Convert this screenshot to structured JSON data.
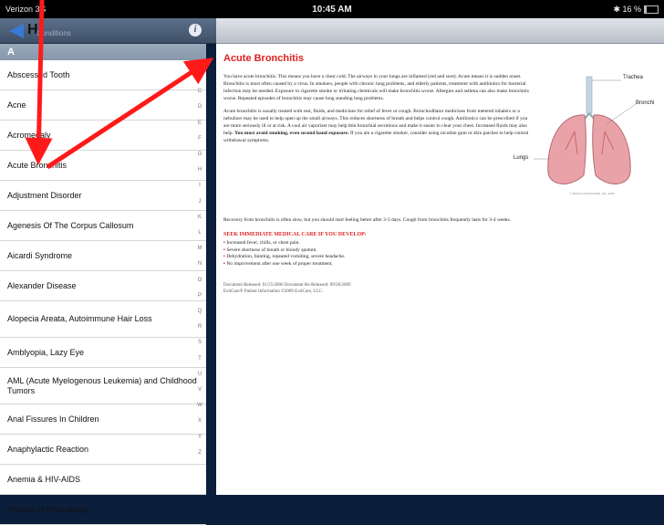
{
  "status": {
    "carrier": "Verizon 3G",
    "time": "10:45 AM",
    "battery": "16 %"
  },
  "left_nav": {
    "home_glyph": "H"
  },
  "search_ghost": "Conditions",
  "section_header": "A",
  "list_items": [
    "Abscessed Tooth",
    "Acne",
    "Acromegaly",
    "Acute Bronchitis",
    "Adjustment Disorder",
    "Agenesis Of The Corpus Callosum",
    "Aicardi Syndrome",
    "Alexander Disease",
    "Alopecia Areata, Autoimmune Hair Loss",
    "Amblyopia, Lazy Eye",
    "AML (Acute Myelogenous Leukemia) and Childhood Tumors",
    "Anal Fissures In Children",
    "Anaphylactic Reaction",
    "Anemia & HIV-AIDS",
    "Anemia of Prematurity"
  ],
  "index_letters": [
    "B",
    "C",
    "D",
    "E",
    "F",
    "G",
    "H",
    "I",
    "J",
    "K",
    "L",
    "M",
    "N",
    "O",
    "P",
    "Q",
    "R",
    "S",
    "T",
    "U",
    "V",
    "W",
    "X",
    "Y",
    "Z"
  ],
  "article": {
    "title": "Acute Bronchitis",
    "para1": "You have acute bronchitis. This means you have a chest cold. The airways in your lungs are inflamed (red and sore). Acute means it is sudden onset. Bronchitis is most often caused by a virus. In smokers, people with chronic lung problems, and elderly patients, treatment with antibiotics for bacterial infection may be needed. Exposure to cigarette smoke or irritating chemicals will make bronchitis worse. Allergies and asthma can also make bronchitis worse. Repeated episodes of bronchitis may cause long standing lung problems.",
    "para2": "Acute bronchitis is usually treated with rest, fluids, and medicines for relief of fever or cough. Bronchodilator medicines from metered inhalers or a nebulizer may be used to help open up the small airways. This reduces shortness of breath and helps control cough. Antibiotics can be prescribed if you are more seriously ill or at risk. A cool air vaporizer may help thin bronchial secretions and make it easier to clear your chest. Increased fluids may also help.",
    "para2_bold": "You must avoid smoking, even second hand exposure.",
    "para2_tail": "If you are a cigarette smoker, consider using nicotine gum or skin patches to help control withdrawal symptoms.",
    "recovery": "Recovery from bronchitis is often slow, but you should start feeling better after 2-3 days. Cough from bronchitis frequently lasts for 3-4 weeks.",
    "seek": "SEEK IMMEDIATE MEDICAL CARE IF YOU DEVELOP:",
    "bullets": [
      "Increased fever, chills, or chest pain.",
      "Severe shortness of breath or bloody sputum.",
      "Dehydration, fainting, repeated vomiting, severe headache.",
      "No improvement after one week of proper treatment."
    ],
    "doc_line1": "Document Released: 01/25/2006 Document Re-Released: 09/26/2009",
    "doc_line2": "ExitCare® Patient Information ©2009 ExitCare, LLC.",
    "figure_labels": {
      "trachea": "Trachea",
      "bronchi": "Bronchi",
      "lungs": "Lungs",
      "copyright": "© RELP & ASSOCIATES, INC. 2004"
    }
  },
  "colors": {
    "arrow": "#ff1a1a",
    "title": "#dd2222",
    "nav": "#4d617b"
  }
}
